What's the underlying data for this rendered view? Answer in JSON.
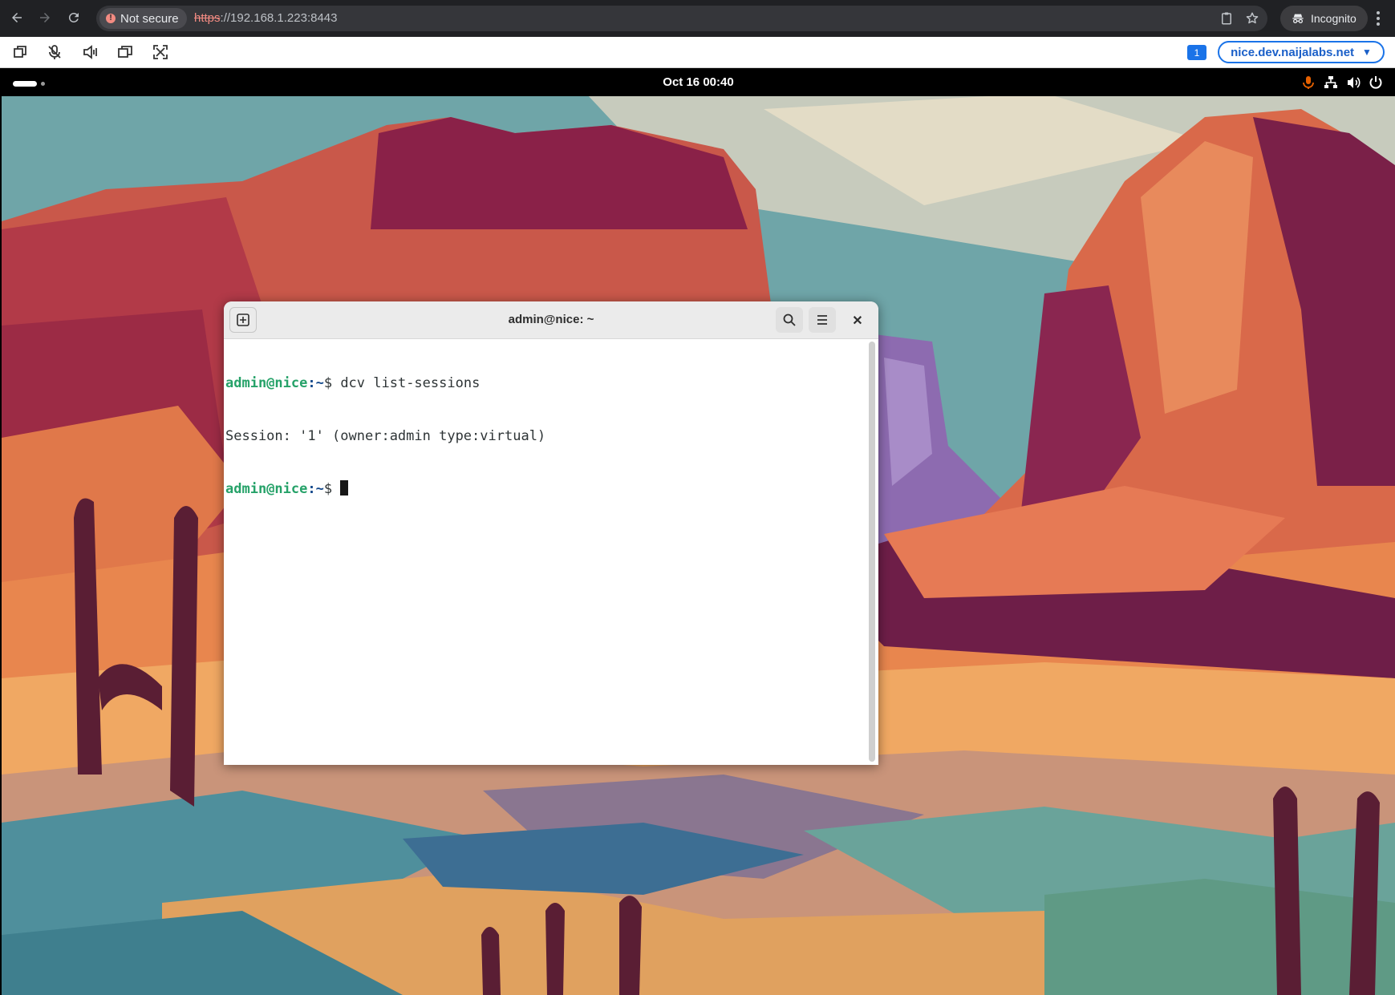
{
  "browser": {
    "security_label": "Not secure",
    "url_scheme": "https",
    "url_rest": "://192.168.1.223:8443",
    "incognito_label": "Incognito"
  },
  "dcv": {
    "tools": [
      "copy-icon",
      "microphone-off-icon",
      "speaker-icon",
      "display-icon",
      "fullscreen-icon"
    ],
    "badge": "1",
    "server": "nice.dev.naijalabs.net"
  },
  "desktop": {
    "clock": "Oct 16  00:40",
    "tray": [
      "microphone-icon",
      "network-icon",
      "volume-icon",
      "power-icon"
    ]
  },
  "terminal": {
    "title": "admin@nice: ~",
    "lines": [
      {
        "user": "admin@nice",
        "path": ":~",
        "text": "$ dcv list-sessions"
      },
      {
        "user": "",
        "path": "",
        "text": "Session: '1' (owner:admin type:virtual)"
      },
      {
        "user": "admin@nice",
        "path": ":~",
        "text": "$ "
      }
    ]
  },
  "colors": {
    "prompt_user": "#26a269",
    "prompt_path": "#12488b",
    "accent": "#1a73e8",
    "mic_active": "#e66100"
  }
}
